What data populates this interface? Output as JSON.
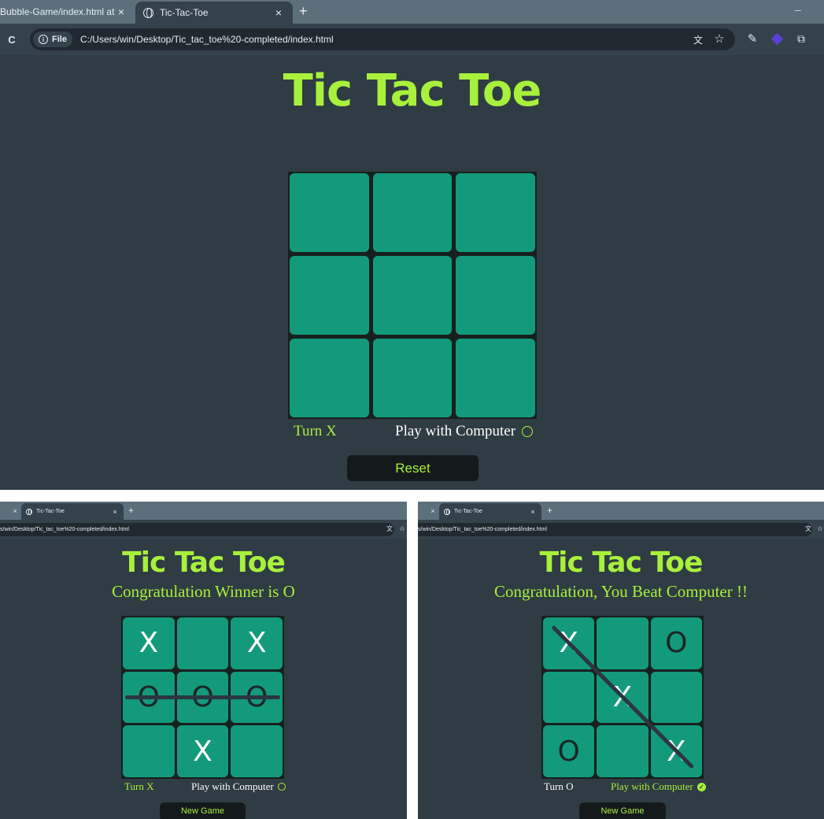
{
  "colors": {
    "accent": "#a8f03c",
    "page_bg": "#2f3c43",
    "cell": "#139a7c",
    "board_bg": "#17201f"
  },
  "main": {
    "tabs": [
      {
        "label": "Bubble-Game/index.html at ma",
        "close": "×",
        "icon": "none"
      },
      {
        "label": "Tic-Tac-Toe",
        "close": "×",
        "icon": "globe-icon"
      }
    ],
    "new_tab": "+",
    "minimize": "–",
    "reload": "C",
    "site_chip": "File",
    "url": "C:/Users/win/Desktop/Tic_tac_toe%20-completed/index.html",
    "title": "Tic Tac Toe",
    "board": [
      "",
      "",
      "",
      "",
      "",
      "",
      "",
      "",
      ""
    ],
    "turn": "Turn X",
    "play_with": "Play with Computer",
    "play_with_checked": false,
    "button": "Reset"
  },
  "left": {
    "tabs": [
      {
        "label": "",
        "close": "×",
        "icon": "none"
      },
      {
        "label": "Tic-Tac-Toe",
        "close": "×",
        "icon": "globe-icon"
      }
    ],
    "new_tab": "+",
    "url": "s/win/Desktop/Tic_tac_toe%20-completed/index.html",
    "title": "Tic Tac Toe",
    "message": "Congratulation Winner is O",
    "board": [
      "X",
      "",
      "X",
      "O",
      "O",
      "O",
      "",
      "X",
      ""
    ],
    "win_line": [
      3,
      5
    ],
    "turn": "Turn X",
    "play_with": "Play with Computer",
    "play_with_checked": false,
    "button": "New Game"
  },
  "right": {
    "tabs": [
      {
        "label": "",
        "close": "×",
        "icon": "none"
      },
      {
        "label": "Tic-Tac-Toe",
        "close": "×",
        "icon": "globe-icon"
      }
    ],
    "new_tab": "+",
    "url": "s/win/Desktop/Tic_tac_toe%20-completed/index.html",
    "title": "Tic Tac Toe",
    "message": "Congratulation, You Beat Computer !!",
    "board": [
      "X",
      "",
      "O",
      "",
      "X",
      "",
      "O",
      "",
      "X"
    ],
    "win_line": [
      0,
      8
    ],
    "turn": "Turn O",
    "play_with": "Play with Computer",
    "play_with_checked": true,
    "button": "New Game"
  }
}
